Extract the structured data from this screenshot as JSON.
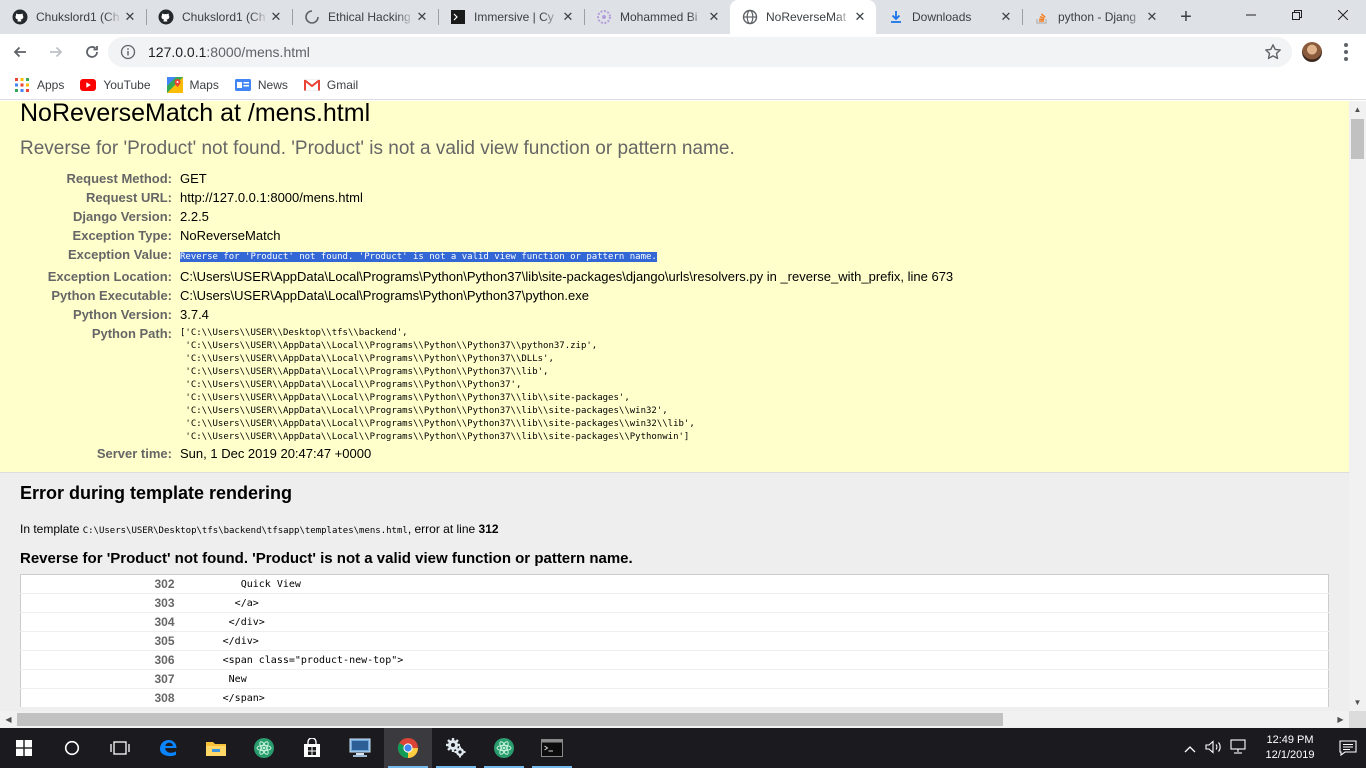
{
  "browser": {
    "tabs": [
      {
        "title": "Chukslord1 (Ch",
        "favicon": "github-icon",
        "active": false
      },
      {
        "title": "Chukslord1 (Ch",
        "favicon": "github-icon",
        "active": false
      },
      {
        "title": "Ethical Hacking",
        "favicon": "loading-icon",
        "active": false
      },
      {
        "title": "Immersive | Cy",
        "favicon": "terminal-icon",
        "active": false
      },
      {
        "title": "Mohammed Bi",
        "favicon": "flower-icon",
        "active": false
      },
      {
        "title": "NoReverseMat",
        "favicon": "globe-icon",
        "active": true
      },
      {
        "title": "Downloads",
        "favicon": "download-icon",
        "active": false
      },
      {
        "title": "python - Djang",
        "favicon": "stackoverflow-icon",
        "active": false
      }
    ],
    "new_tab_label": "+",
    "url_host": "127.0.0.1",
    "url_rest": ":8000/mens.html",
    "bookmarks": [
      {
        "label": "Apps",
        "icon": "apps-grid-icon"
      },
      {
        "label": "YouTube",
        "icon": "youtube-icon"
      },
      {
        "label": "Maps",
        "icon": "maps-icon"
      },
      {
        "label": "News",
        "icon": "news-icon"
      },
      {
        "label": "Gmail",
        "icon": "gmail-icon"
      }
    ]
  },
  "page": {
    "title": "NoReverseMatch at /mens.html",
    "subtitle": "Reverse for 'Product' not found. 'Product' is not a valid view function or pattern name.",
    "meta": {
      "request_method_label": "Request Method:",
      "request_method": "GET",
      "request_url_label": "Request URL:",
      "request_url": "http://127.0.0.1:8000/mens.html",
      "django_version_label": "Django Version:",
      "django_version": "2.2.5",
      "exception_type_label": "Exception Type:",
      "exception_type": "NoReverseMatch",
      "exception_value_label": "Exception Value:",
      "exception_value": "Reverse for 'Product' not found. 'Product' is not a valid view function or pattern name.",
      "exception_location_label": "Exception Location:",
      "exception_location": "C:\\Users\\USER\\AppData\\Local\\Programs\\Python\\Python37\\lib\\site-packages\\django\\urls\\resolvers.py in _reverse_with_prefix, line 673",
      "python_executable_label": "Python Executable:",
      "python_executable": "C:\\Users\\USER\\AppData\\Local\\Programs\\Python\\Python37\\python.exe",
      "python_version_label": "Python Version:",
      "python_version": "3.7.4",
      "python_path_label": "Python Path:",
      "python_path": "['C:\\\\Users\\\\USER\\\\Desktop\\\\tfs\\\\backend',\n 'C:\\\\Users\\\\USER\\\\AppData\\\\Local\\\\Programs\\\\Python\\\\Python37\\\\python37.zip',\n 'C:\\\\Users\\\\USER\\\\AppData\\\\Local\\\\Programs\\\\Python\\\\Python37\\\\DLLs',\n 'C:\\\\Users\\\\USER\\\\AppData\\\\Local\\\\Programs\\\\Python\\\\Python37\\\\lib',\n 'C:\\\\Users\\\\USER\\\\AppData\\\\Local\\\\Programs\\\\Python\\\\Python37',\n 'C:\\\\Users\\\\USER\\\\AppData\\\\Local\\\\Programs\\\\Python\\\\Python37\\\\lib\\\\site-packages',\n 'C:\\\\Users\\\\USER\\\\AppData\\\\Local\\\\Programs\\\\Python\\\\Python37\\\\lib\\\\site-packages\\\\win32',\n 'C:\\\\Users\\\\USER\\\\AppData\\\\Local\\\\Programs\\\\Python\\\\Python37\\\\lib\\\\site-packages\\\\win32\\\\lib',\n 'C:\\\\Users\\\\USER\\\\AppData\\\\Local\\\\Programs\\\\Python\\\\Python37\\\\lib\\\\site-packages\\\\Pythonwin']",
      "server_time_label": "Server time:",
      "server_time": "Sun, 1 Dec 2019 20:47:47 +0000"
    },
    "template_error": {
      "heading": "Error during template rendering",
      "in_template_prefix": "In template ",
      "template_path": "C:\\Users\\USER\\Desktop\\tfs\\backend\\tfsapp\\templates\\mens.html",
      "error_at_line_text": ", error at line ",
      "error_line": "312",
      "message": "Reverse for 'Product' not found. 'Product' is not a valid view function or pattern name.",
      "source_lines": [
        {
          "num": "302",
          "code": "          Quick View"
        },
        {
          "num": "303",
          "code": "         </a>"
        },
        {
          "num": "304",
          "code": "        </div>"
        },
        {
          "num": "305",
          "code": "       </div>"
        },
        {
          "num": "306",
          "code": "       <span class=\"product-new-top\">"
        },
        {
          "num": "307",
          "code": "        New"
        },
        {
          "num": "308",
          "code": "       </span>"
        }
      ]
    }
  },
  "taskbar": {
    "time": "12:49 PM",
    "date": "12/1/2019",
    "apps": [
      "start-icon",
      "search-icon",
      "task-view-icon",
      "edge-icon",
      "file-explorer-icon",
      "atom-icon",
      "store-icon",
      "remote-desktop-icon",
      "chrome-icon",
      "settings-gear-icon",
      "atom-icon",
      "cmd-icon"
    ]
  },
  "colors": {
    "summary_bg": "#ffffcc",
    "selection": "#3367d6",
    "tabstrip": "#dee1e6",
    "taskbar": "#1b1b1f"
  }
}
